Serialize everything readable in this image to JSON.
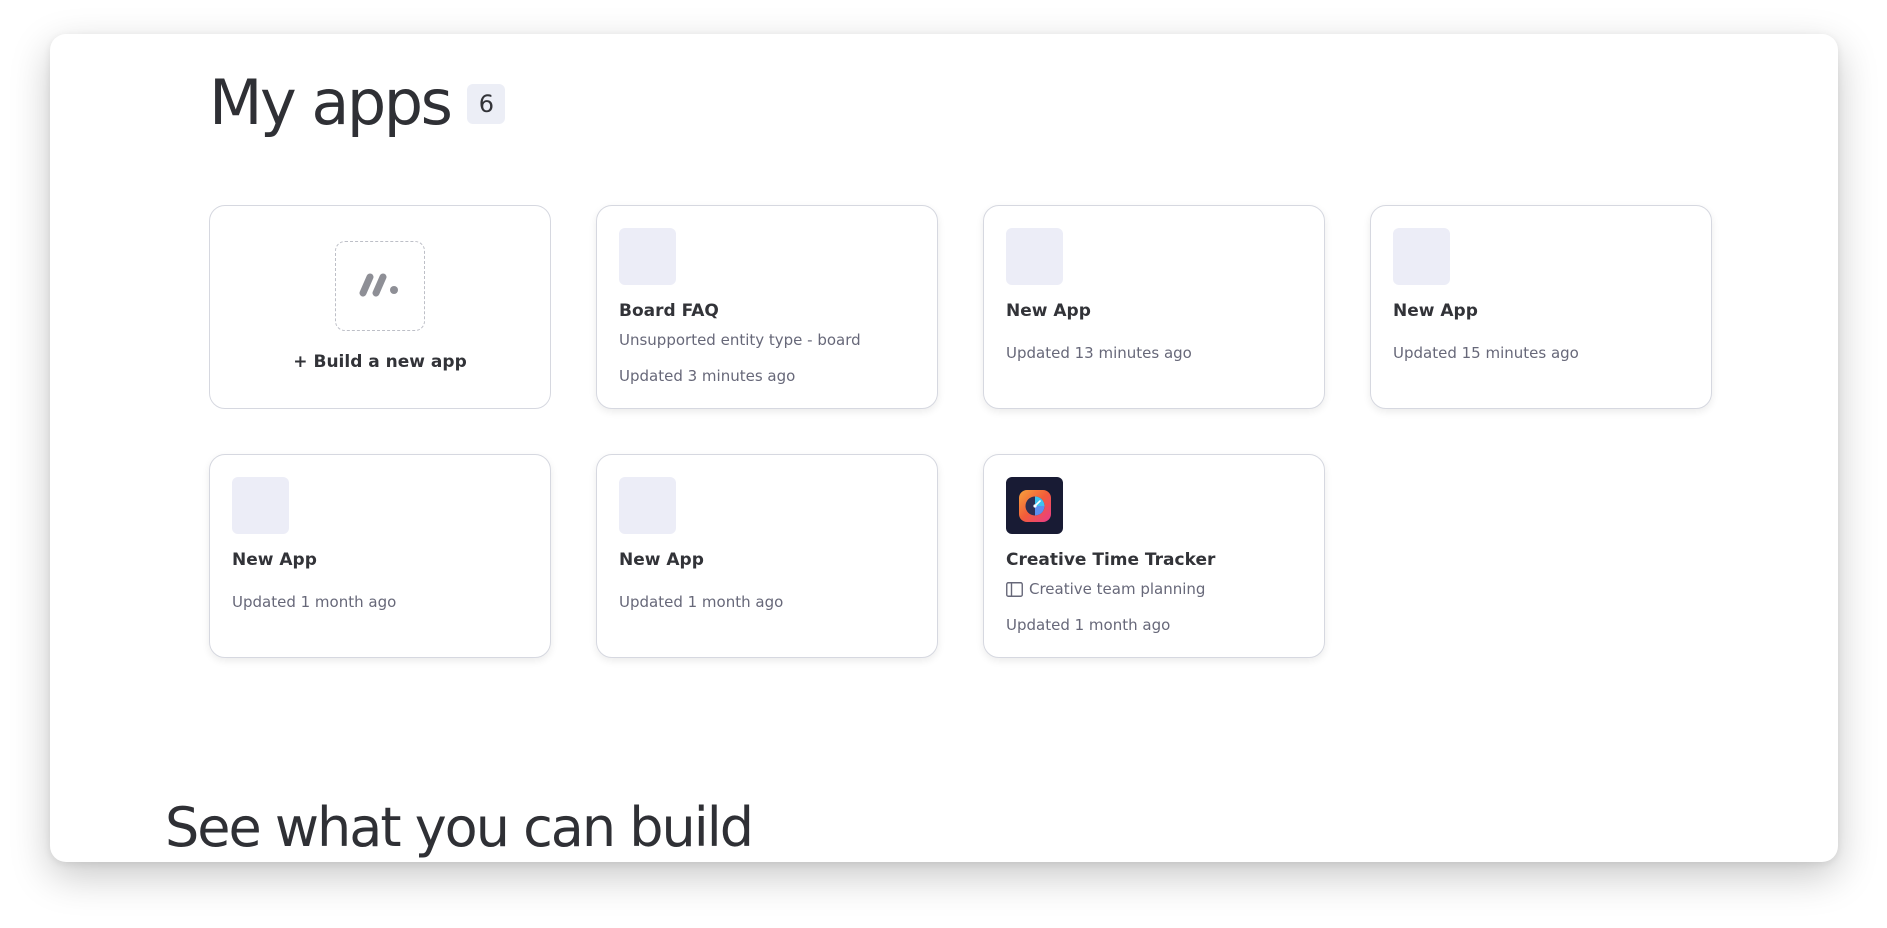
{
  "header": {
    "title": "My apps",
    "count": "6"
  },
  "new_app_card": {
    "label": "Build a new app",
    "plus": "+"
  },
  "apps": [
    {
      "name": "Board FAQ",
      "subtitle": "Unsupported entity type - board",
      "updated": "Updated 3 minutes ago",
      "icon": "placeholder"
    },
    {
      "name": "New App",
      "updated": "Updated 13 minutes ago",
      "icon": "placeholder"
    },
    {
      "name": "New App",
      "updated": "Updated 15 minutes ago",
      "icon": "placeholder"
    },
    {
      "name": "New App",
      "updated": "Updated 1 month ago",
      "icon": "placeholder"
    },
    {
      "name": "New App",
      "updated": "Updated 1 month ago",
      "icon": "placeholder"
    },
    {
      "name": "Creative Time Tracker",
      "subtitle": "Creative team planning",
      "subtitle_icon": "board-icon",
      "updated": "Updated 1 month ago",
      "icon": "time-tracker-app-icon"
    }
  ],
  "section2": {
    "title": "See what you can build"
  },
  "colors": {
    "text_primary": "#323338",
    "text_secondary": "#676879",
    "card_border": "#d6d8e0",
    "icon_placeholder": "#ecedf7",
    "badge_bg": "#eceef6",
    "dark_icon_bg": "#181b34",
    "tracker_gradient_start": "#f25c3a",
    "tracker_gradient_end": "#e83a8c"
  }
}
